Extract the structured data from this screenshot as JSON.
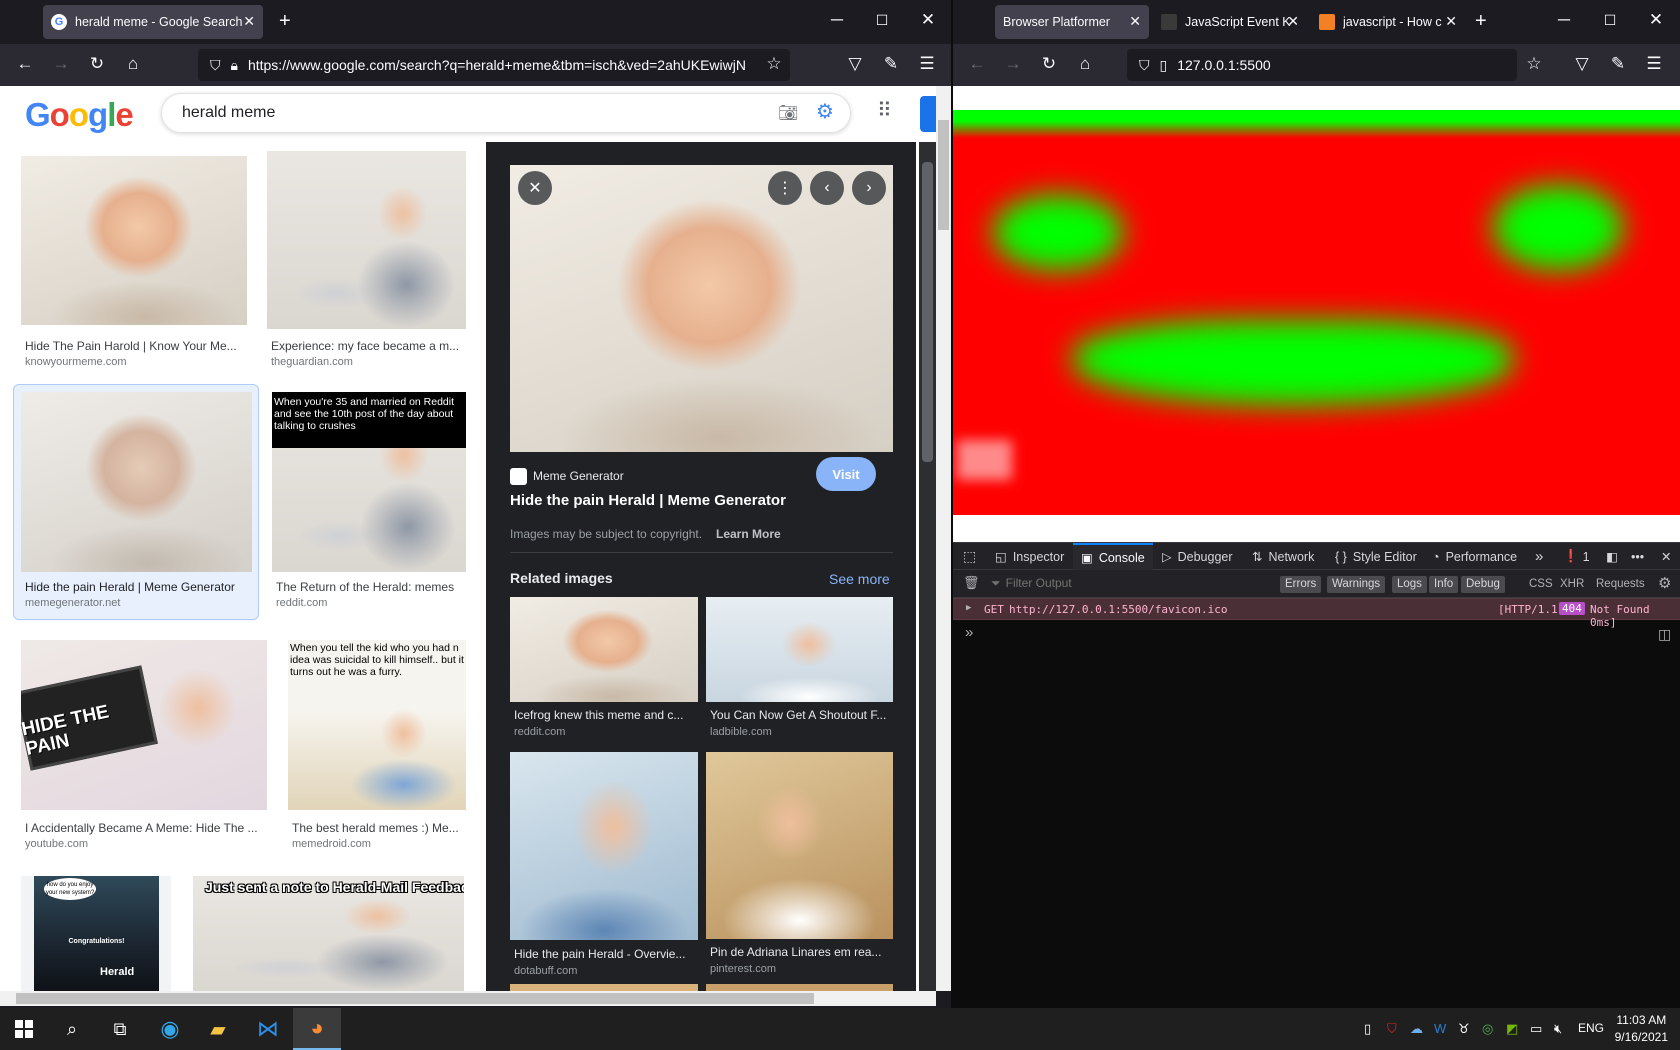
{
  "left_window": {
    "tab": {
      "title": "herald meme - Google Search"
    },
    "url": "https://www.google.com/search?q=herald+meme&tbm=isch&ved=2ahUKEwiwjN",
    "search": {
      "logo": "Google",
      "query": "herald meme"
    },
    "results": [
      {
        "title": "Hide The Pain Harold | Know Your Me...",
        "source": "knowyourmeme.com"
      },
      {
        "title": "Experience: my face became a m...",
        "source": "theguardian.com"
      },
      {
        "title": "Hide the pain Herald | Meme Generator",
        "source": "memegenerator.net"
      },
      {
        "title": "The Return of the Herald: memes",
        "source": "reddit.com"
      },
      {
        "title": "I Accidentally Became A Meme: Hide The ...",
        "source": "youtube.com"
      },
      {
        "title": "The best herald memes :) Me...",
        "source": "memedroid.com"
      }
    ],
    "thumb_captions": {
      "reddit": "When you're 35 and married on Reddit and see the 10th post of the day about talking to crushes",
      "youtube": "HIDE THE PAIN",
      "memedroid": "When you tell the kid who you had n idea was suicidal to kill himself.. but it turns out he was a furry.",
      "card7_top": "how do you enjoy your new system?",
      "card7_congrats": "Congratulations!",
      "card7_name": "Herald",
      "card8": "Just sent a note to Herald-Mail Feedback"
    },
    "viewer": {
      "site": "Meme Generator",
      "title": "Hide the pain Herald | Meme Generator",
      "visit": "Visit",
      "copyright": "Images may be subject to copyright.",
      "learn_more": "Learn More",
      "related_heading": "Related images",
      "see_more": "See more",
      "related": [
        {
          "title": "Icefrog knew this meme and c...",
          "source": "reddit.com"
        },
        {
          "title": "You Can Now Get A Shoutout F...",
          "source": "ladbible.com"
        },
        {
          "title": "Hide the pain Herald - Overvie...",
          "source": "dotabuff.com"
        },
        {
          "title": "Pin de Adriana Linares em rea...",
          "source": "pinterest.com"
        }
      ]
    }
  },
  "right_window": {
    "tabs": [
      {
        "title": "Browser Platformer"
      },
      {
        "title": "JavaScript Event K"
      },
      {
        "title": "javascript - How c"
      }
    ],
    "url": "127.0.0.1:5500",
    "devtools": {
      "tabs": [
        "Inspector",
        "Console",
        "Debugger",
        "Network",
        "Style Editor",
        "Performance"
      ],
      "error_count": "1",
      "filter_placeholder": "Filter Output",
      "filters": [
        "Errors",
        "Warnings",
        "Logs",
        "Info",
        "Debug",
        "CSS",
        "XHR",
        "Requests"
      ],
      "log": {
        "method": "GET",
        "url": "http://127.0.0.1:5500/favicon.ico",
        "status_prefix": "[HTTP/1.1",
        "status_code": "404",
        "status_suffix": "Not Found 0ms]"
      },
      "prompt": "»"
    }
  },
  "taskbar": {
    "lang": "ENG",
    "time": "11:03 AM",
    "date": "9/16/2021"
  },
  "colors": {
    "accent": "#0a84ff",
    "google_blue": "#4285f4",
    "canvas_red": "#ff0000",
    "canvas_green": "#00ff00"
  }
}
